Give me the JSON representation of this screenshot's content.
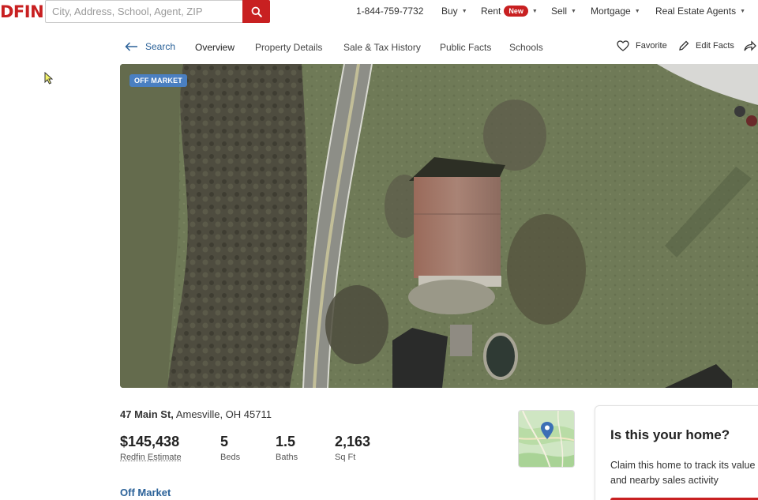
{
  "header": {
    "logo_text": "DFIN",
    "search_placeholder": "City, Address, School, Agent, ZIP",
    "phone": "1-844-759-7732",
    "nav": [
      {
        "label": "Buy"
      },
      {
        "label": "Rent",
        "badge": "New"
      },
      {
        "label": "Sell"
      },
      {
        "label": "Mortgage"
      },
      {
        "label": "Real Estate Agents"
      }
    ]
  },
  "subnav": {
    "back_label": "Search",
    "tabs": [
      "Overview",
      "Property Details",
      "Sale & Tax History",
      "Public Facts",
      "Schools"
    ],
    "active_tab": "Overview",
    "favorite_label": "Favorite",
    "edit_label": "Edit Facts"
  },
  "hero": {
    "badge": "OFF MARKET"
  },
  "property": {
    "street": "47 Main St,",
    "city": "Amesville, OH 45711",
    "price": "$145,438",
    "price_label": "Redfin Estimate",
    "beds": "5",
    "beds_label": "Beds",
    "baths": "1.5",
    "baths_label": "Baths",
    "sqft": "2,163",
    "sqft_label": "Sq Ft",
    "status": "Off Market"
  },
  "claim": {
    "title": "Is this your home?",
    "body": "Claim this home to track its value and nearby sales activity"
  },
  "colors": {
    "brand_red": "#c82021",
    "link_blue": "#2a6198",
    "badge_blue": "#4a7fc1"
  }
}
